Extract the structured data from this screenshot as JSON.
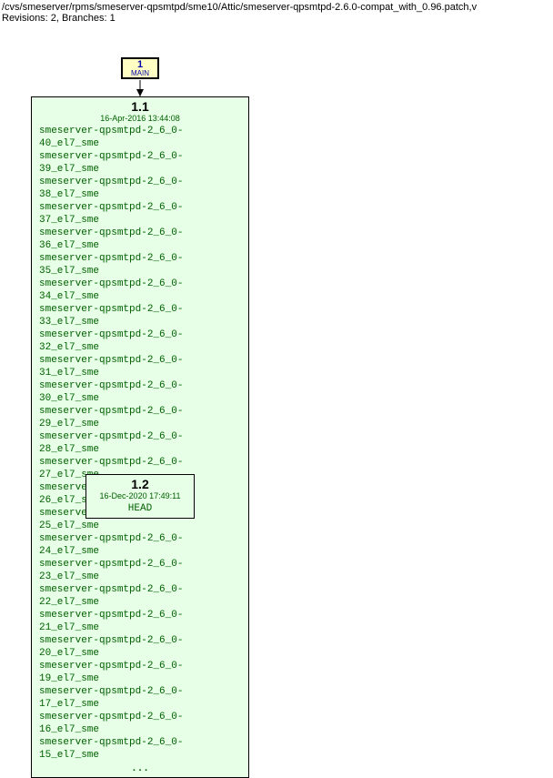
{
  "header": {
    "path": "/cvs/smeserver/rpms/smeserver-qpsmtpd/sme10/Attic/smeserver-qpsmtpd-2.6.0-compat_with_0.96.patch,v",
    "revisions_line": "Revisions: 2, Branches: 1"
  },
  "branch": {
    "number": "1",
    "name": "MAIN"
  },
  "node1": {
    "version": "1.1",
    "date": "16-Apr-2016 13:44:08",
    "tags": [
      "smeserver-qpsmtpd-2_6_0-40_el7_sme",
      "smeserver-qpsmtpd-2_6_0-39_el7_sme",
      "smeserver-qpsmtpd-2_6_0-38_el7_sme",
      "smeserver-qpsmtpd-2_6_0-37_el7_sme",
      "smeserver-qpsmtpd-2_6_0-36_el7_sme",
      "smeserver-qpsmtpd-2_6_0-35_el7_sme",
      "smeserver-qpsmtpd-2_6_0-34_el7_sme",
      "smeserver-qpsmtpd-2_6_0-33_el7_sme",
      "smeserver-qpsmtpd-2_6_0-32_el7_sme",
      "smeserver-qpsmtpd-2_6_0-31_el7_sme",
      "smeserver-qpsmtpd-2_6_0-30_el7_sme",
      "smeserver-qpsmtpd-2_6_0-29_el7_sme",
      "smeserver-qpsmtpd-2_6_0-28_el7_sme",
      "smeserver-qpsmtpd-2_6_0-27_el7_sme",
      "smeserver-qpsmtpd-2_6_0-26_el7_sme",
      "smeserver-qpsmtpd-2_6_0-25_el7_sme",
      "smeserver-qpsmtpd-2_6_0-24_el7_sme",
      "smeserver-qpsmtpd-2_6_0-23_el7_sme",
      "smeserver-qpsmtpd-2_6_0-22_el7_sme",
      "smeserver-qpsmtpd-2_6_0-21_el7_sme",
      "smeserver-qpsmtpd-2_6_0-20_el7_sme",
      "smeserver-qpsmtpd-2_6_0-19_el7_sme",
      "smeserver-qpsmtpd-2_6_0-17_el7_sme",
      "smeserver-qpsmtpd-2_6_0-16_el7_sme",
      "smeserver-qpsmtpd-2_6_0-15_el7_sme"
    ],
    "ellipsis": "..."
  },
  "node2": {
    "version": "1.2",
    "date": "16-Dec-2020 17:49:11",
    "tag": "HEAD"
  }
}
